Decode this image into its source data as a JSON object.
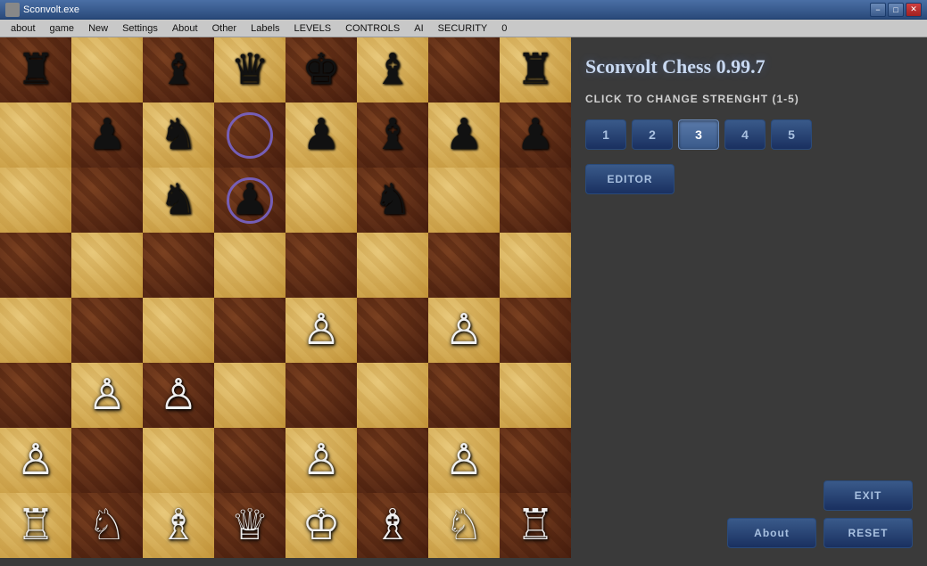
{
  "titlebar": {
    "title": "Sconvolt.exe",
    "minimize_label": "−",
    "maximize_label": "□",
    "close_label": "✕"
  },
  "menubar": {
    "items": [
      "about",
      "game",
      "New",
      "Settings",
      "About",
      "Other",
      "Labels",
      "LEVELS",
      "CONTROLS",
      "AI",
      "SECURITY",
      "0"
    ]
  },
  "game_title": "Sconvolt Chess 0.99.7",
  "strength_label": "CLICK TO CHANGE STRENGHT (1-5)",
  "strength_buttons": [
    "1",
    "2",
    "3",
    "4",
    "5"
  ],
  "active_strength": "3",
  "editor_btn_label": "EDITOR",
  "exit_btn_label": "EXIT",
  "about_btn_label": "About",
  "reset_btn_label": "RESET",
  "board": {
    "rows": [
      [
        "br",
        "",
        "bb",
        "bq",
        "bk",
        "ba",
        "",
        "br2"
      ],
      [
        "",
        "bp",
        "bn",
        "circle",
        "bp2",
        "ba2",
        "bp3",
        "bpawn"
      ],
      [
        "",
        "",
        "bn2",
        "circled_pawn",
        "",
        "bn3",
        "",
        ""
      ],
      [
        "",
        "",
        "",
        "",
        "",
        "",
        "",
        ""
      ],
      [
        "",
        "",
        "",
        "",
        "wp",
        "",
        "wp2",
        ""
      ],
      [
        "",
        "wp3",
        "wp4",
        "",
        "",
        "",
        "",
        ""
      ],
      [
        "wp5",
        "",
        "",
        "",
        "wp6",
        "",
        "wp7",
        ""
      ],
      [
        "wr",
        "wn",
        "wb",
        "wq",
        "wk",
        "wa",
        "wn2",
        "wr2"
      ]
    ]
  }
}
